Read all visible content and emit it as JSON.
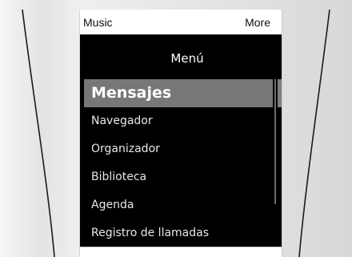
{
  "softkeys": {
    "left": "Music",
    "right": "More"
  },
  "menu": {
    "title": "Menú",
    "items": [
      {
        "label": "Mensajes",
        "selected": true
      },
      {
        "label": "Navegador"
      },
      {
        "label": "Organizador"
      },
      {
        "label": "Biblioteca"
      },
      {
        "label": "Agenda"
      },
      {
        "label": "Registro de llamadas"
      }
    ]
  },
  "colors": {
    "screen_background": "#000000",
    "selected_item_background": "#777777",
    "softkey_bar_background": "#ffffff"
  }
}
